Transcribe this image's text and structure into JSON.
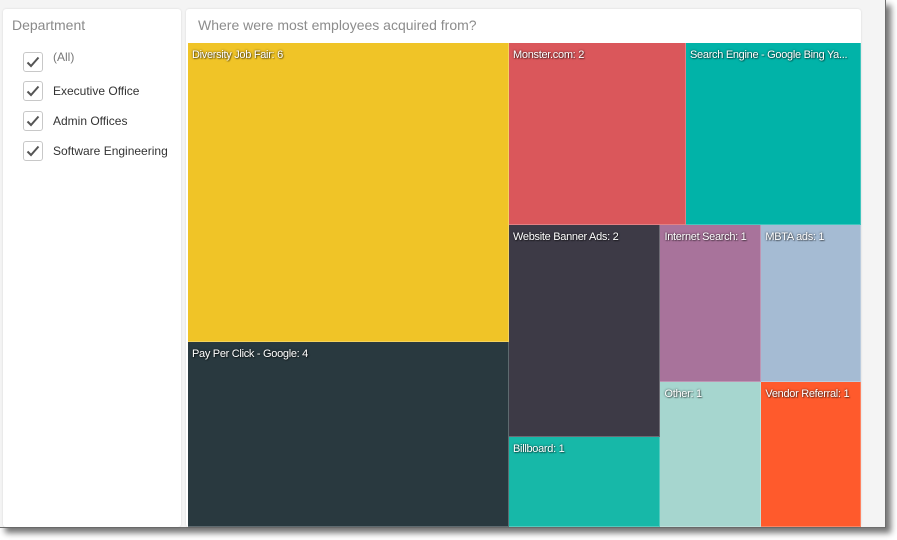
{
  "slicer": {
    "title": "Department",
    "items": [
      {
        "label": "(All)",
        "checked": true
      },
      {
        "label": "Executive Office",
        "checked": true
      },
      {
        "label": "Admin Offices",
        "checked": true
      },
      {
        "label": "Software Engineering",
        "checked": true
      }
    ]
  },
  "card": {
    "title": "Where were most employees acquired from?"
  },
  "chart_data": {
    "type": "treemap",
    "title": "Where were most employees acquired from?",
    "items": [
      {
        "label": "Diversity Job Fair: 6",
        "category": "Diversity Job Fair",
        "value": 6,
        "color": "#F0C427"
      },
      {
        "label": "Pay Per Click - Google: 4",
        "category": "Pay Per Click - Google",
        "value": 4,
        "color": "#29393F"
      },
      {
        "label": "Monster.com: 2",
        "category": "Monster.com",
        "value": 2,
        "color": "#DA575B"
      },
      {
        "label": "Search Engine - Google Bing Ya...",
        "category": "Search Engine - Google Bing Yahoo",
        "value": 2,
        "color": "#01B3A8"
      },
      {
        "label": "Website Banner Ads: 2",
        "category": "Website Banner Ads",
        "value": 2,
        "color": "#3D3A46"
      },
      {
        "label": "Internet Search: 1",
        "category": "Internet Search",
        "value": 1,
        "color": "#A8739B"
      },
      {
        "label": "MBTA ads: 1",
        "category": "MBTA ads",
        "value": 1,
        "color": "#A5BBD3"
      },
      {
        "label": "Billboard: 1",
        "category": "Billboard",
        "value": 1,
        "color": "#17B8A8"
      },
      {
        "label": "Other: 1",
        "category": "Other",
        "value": 1,
        "color": "#A6D6CF"
      },
      {
        "label": "Vendor Referral: 1",
        "category": "Vendor Referral",
        "value": 1,
        "color": "#FF5A2C"
      }
    ]
  }
}
